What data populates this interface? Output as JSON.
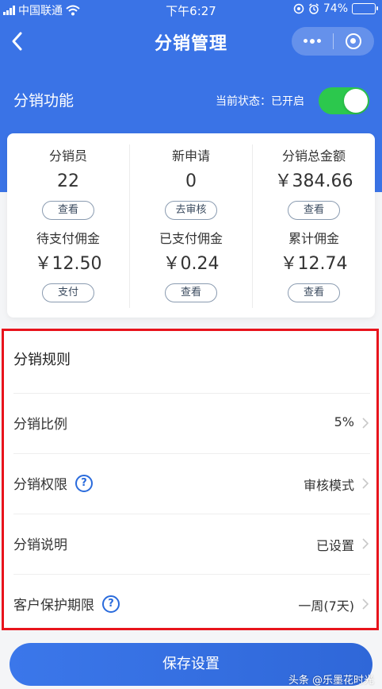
{
  "status_bar": {
    "carrier": "中国联通",
    "time": "下午6:27",
    "battery": "74%",
    "battery_level": 0.74
  },
  "nav": {
    "title": "分销管理"
  },
  "function": {
    "title": "分销功能",
    "status_text": "当前状态：已开启",
    "enabled": true,
    "toggle_color": "#2cc84d"
  },
  "stats": [
    {
      "label": "分销员",
      "value": "22",
      "button": "查看"
    },
    {
      "label": "新申请",
      "value": "0",
      "button": "去审核"
    },
    {
      "label": "分销总金额",
      "value": "￥384.66",
      "button": "查看"
    },
    {
      "label": "待支付佣金",
      "value": "￥12.50",
      "button": "支付"
    },
    {
      "label": "已支付佣金",
      "value": "￥0.24",
      "button": "查看"
    },
    {
      "label": "累计佣金",
      "value": "￥12.74",
      "button": "查看"
    }
  ],
  "rules": {
    "title": "分销规则",
    "items": [
      {
        "label": "分销比例",
        "value": "5%",
        "help": false
      },
      {
        "label": "分销权限",
        "value": "审核模式",
        "help": true
      },
      {
        "label": "分销说明",
        "value": "已设置",
        "help": false
      },
      {
        "label": "客户保护期限",
        "value": "一周(7天)",
        "help": true
      }
    ]
  },
  "save_label": "保存设置",
  "watermark": "头条 @乐墨花时光",
  "colors": {
    "brand": "#3a73e6",
    "highlight": "#e8141c"
  }
}
